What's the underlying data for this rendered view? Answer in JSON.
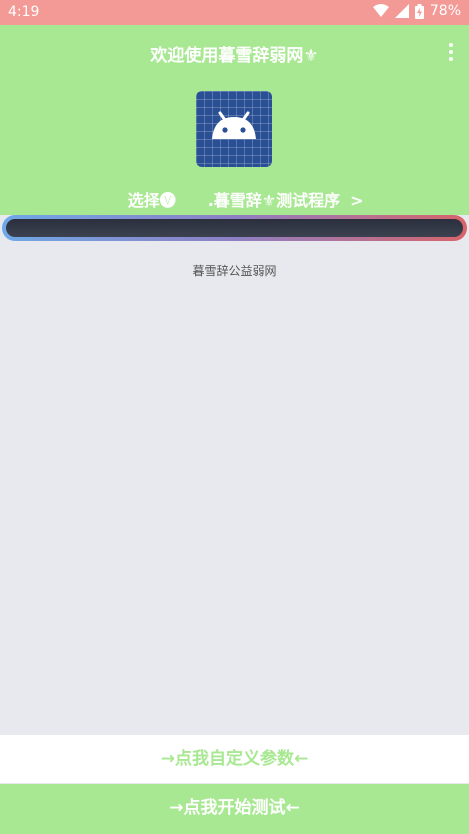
{
  "status_bar": {
    "time": "4:19",
    "battery": "78%",
    "icons": [
      "wifi-icon",
      "signal-icon",
      "battery-icon"
    ]
  },
  "header": {
    "title": "欢迎使用暮雪辞弱网⚜",
    "select_label": "选择🅥　　.暮雪辞⚜测试程序",
    "select_arrow": ">",
    "menu_icon": "more-vert-icon",
    "app_icon": "android-icon"
  },
  "content": {
    "footer_text": "暮雪辞公益弱网"
  },
  "buttons": {
    "custom_params": "→点我自定义参数←",
    "start_test": "→点我开始测试←"
  },
  "colors": {
    "status_bar": "#f39a96",
    "accent_green": "#a8e892",
    "background": "#e8e9ee"
  }
}
